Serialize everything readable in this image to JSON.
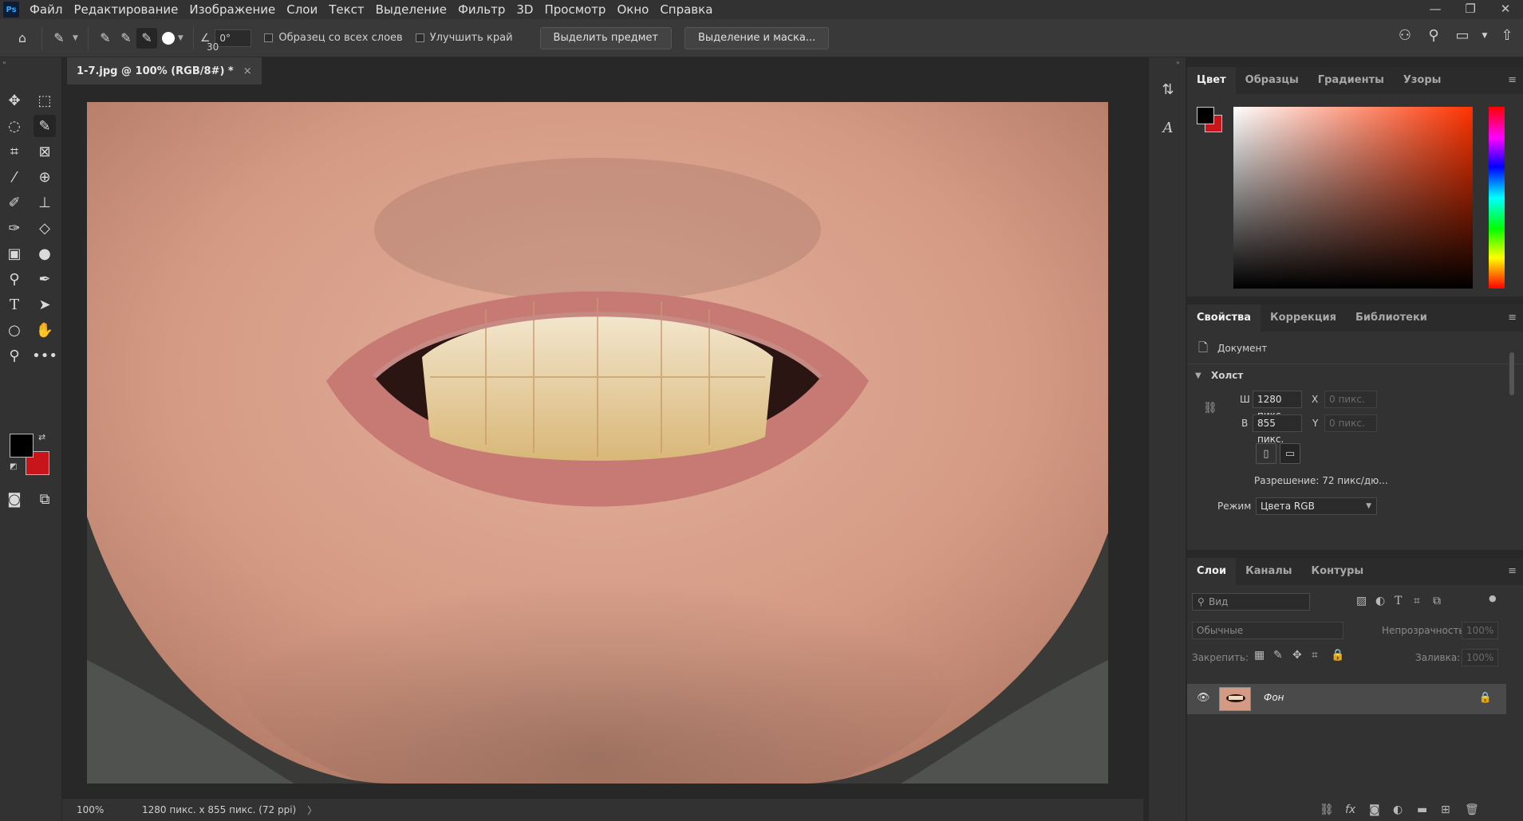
{
  "app": {
    "logo_text": "Ps"
  },
  "menubar": {
    "items": [
      "Файл",
      "Редактирование",
      "Изображение",
      "Слои",
      "Текст",
      "Выделение",
      "Фильтр",
      "3D",
      "Просмотр",
      "Окно",
      "Справка"
    ],
    "window_controls": {
      "minimize": "—",
      "restore": "❐",
      "close": "✕"
    }
  },
  "options": {
    "brush_size": "30",
    "angle": "0°",
    "sample_all_layers": "Образец со всех слоев",
    "enhance_edge": "Улучшить край",
    "select_subject": "Выделить предмет",
    "select_and_mask": "Выделение и маска..."
  },
  "document": {
    "tab_title": "1-7.jpg @ 100% (RGB/8#) *",
    "close_glyph": "×"
  },
  "status": {
    "zoom": "100%",
    "info": "1280 пикс. x 855 пикс. (72 ppi)",
    "arrow": "〉"
  },
  "color_panel": {
    "tabs": [
      "Цвет",
      "Образцы",
      "Градиенты",
      "Узоры"
    ],
    "colors": {
      "foreground": "#000000",
      "background": "#c8141b"
    }
  },
  "properties_panel": {
    "tabs": [
      "Свойства",
      "Коррекция",
      "Библиотеки"
    ],
    "doc_label": "Документ",
    "canvas_label": "Холст",
    "width_label": "Ш",
    "width_value": "1280 пикс",
    "height_label": "В",
    "height_value": "855 пикс.",
    "x_label": "X",
    "x_placeholder": "0 пикс.",
    "y_label": "Y",
    "y_placeholder": "0 пикс.",
    "resolution": "Разрешение: 72 пикс/дю...",
    "mode_label": "Режим",
    "mode_value": "Цвета RGB"
  },
  "layers_panel": {
    "tabs": [
      "Слои",
      "Каналы",
      "Контуры"
    ],
    "search_placeholder": "Вид",
    "blend_mode": "Обычные",
    "opacity_label": "Непрозрачность:",
    "opacity_value": "100%",
    "lock_label": "Закрепить:",
    "fill_label": "Заливка:",
    "fill_value": "100%",
    "layers": [
      {
        "name": "Фон",
        "visible": true,
        "locked": true
      }
    ]
  }
}
